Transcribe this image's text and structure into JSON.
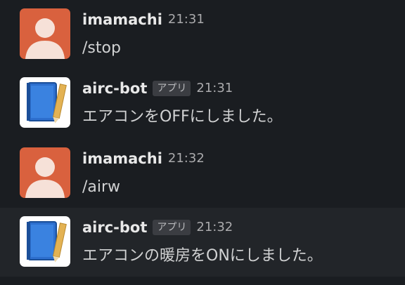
{
  "colors": {
    "background": "#1a1d21",
    "hover_row": "#222529",
    "user_avatar_bg": "#d9613e",
    "user_avatar_fg": "#f6e1d8",
    "bot_avatar_bg": "#ffffff",
    "bot_book": "#2d6fce",
    "bot_pencil": "#e3b253"
  },
  "messages": [
    {
      "sender": "imamachi",
      "time": "21:31",
      "badge": "",
      "text": "/stop",
      "avatar": "user-avatar-icon"
    },
    {
      "sender": "airc-bot",
      "time": "21:31",
      "badge": "アプリ",
      "text": "エアコンをOFFにしました。",
      "avatar": "notebook-pencil-icon"
    },
    {
      "sender": "imamachi",
      "time": "21:32",
      "badge": "",
      "text": "/airw",
      "avatar": "user-avatar-icon"
    },
    {
      "sender": "airc-bot",
      "time": "21:32",
      "badge": "アプリ",
      "text": "エアコンの暖房をONにしました。",
      "avatar": "notebook-pencil-icon"
    }
  ]
}
